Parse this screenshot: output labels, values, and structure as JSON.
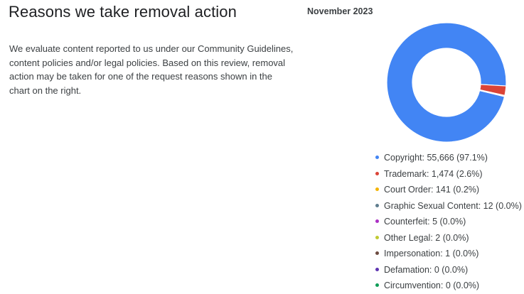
{
  "header": {
    "title": "Reasons we take removal action",
    "description": "We evaluate content reported to us under our Community Guidelines, content policies and/or legal policies. Based on this review, removal action may be taken for one of the request reasons shown in the chart on the right.",
    "period": "November 2023"
  },
  "chart_data": {
    "type": "pie",
    "style": "donut",
    "title": "November 2023",
    "legend_position": "bottom",
    "slices": [
      {
        "label": "Copyright",
        "value": 55666,
        "percent": 97.1,
        "color": "#4285f4",
        "text": "Copyright: 55,666 (97.1%)"
      },
      {
        "label": "Trademark",
        "value": 1474,
        "percent": 2.6,
        "color": "#db4437",
        "text": "Trademark: 1,474 (2.6%)"
      },
      {
        "label": "Court Order",
        "value": 141,
        "percent": 0.2,
        "color": "#f4b400",
        "text": "Court Order: 141 (0.2%)"
      },
      {
        "label": "Graphic Sexual Content",
        "value": 12,
        "percent": 0.0,
        "color": "#5f7d8e",
        "text": "Graphic Sexual Content: 12 (0.0%)"
      },
      {
        "label": "Counterfeit",
        "value": 5,
        "percent": 0.0,
        "color": "#ab30c4",
        "text": "Counterfeit: 5 (0.0%)"
      },
      {
        "label": "Other Legal",
        "value": 2,
        "percent": 0.0,
        "color": "#c0ca33",
        "text": "Other Legal: 2 (0.0%)"
      },
      {
        "label": "Impersonation",
        "value": 1,
        "percent": 0.0,
        "color": "#6d4c41",
        "text": "Impersonation: 1 (0.0%)"
      },
      {
        "label": "Defamation",
        "value": 0,
        "percent": 0.0,
        "color": "#5e35b1",
        "text": "Defamation: 0 (0.0%)"
      },
      {
        "label": "Circumvention",
        "value": 0,
        "percent": 0.0,
        "color": "#0f9d58",
        "text": "Circumvention: 0 (0.0%)"
      }
    ]
  }
}
